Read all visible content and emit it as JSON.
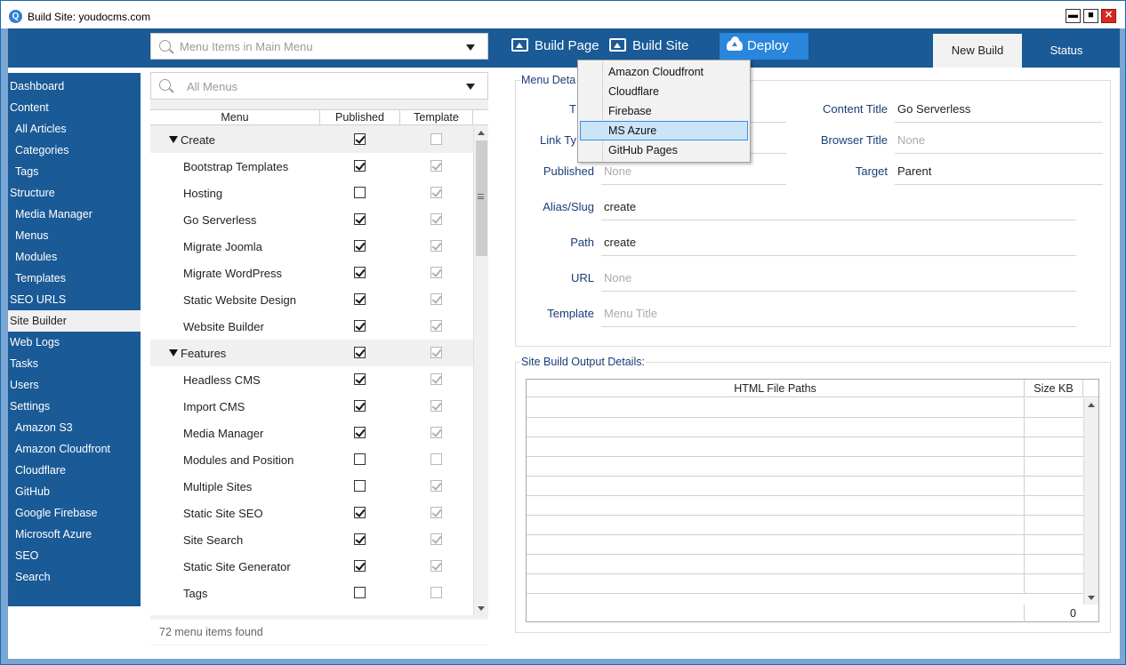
{
  "window": {
    "title": "Build Site: youdocms.com",
    "app_icon": "Q"
  },
  "window_controls": {
    "minimize": "▬",
    "maximize": "■",
    "close": "✕"
  },
  "toolbar": {
    "menu_search_placeholder": "Menu Items in Main Menu",
    "build_page": "Build Page",
    "build_site": "Build Site",
    "deploy": "Deploy"
  },
  "tabs": [
    {
      "label": "New Build",
      "active": true
    },
    {
      "label": "Status",
      "active": false
    }
  ],
  "sidebar": {
    "items": [
      {
        "label": "Dashboard"
      },
      {
        "label": "Content"
      },
      {
        "label": "All Articles"
      },
      {
        "label": "Categories"
      },
      {
        "label": "Tags"
      },
      {
        "label": "Structure"
      },
      {
        "label": "Media Manager"
      },
      {
        "label": "Menus"
      },
      {
        "label": "Modules"
      },
      {
        "label": "Templates"
      },
      {
        "label": "SEO URLS"
      },
      {
        "label": "Site Builder"
      },
      {
        "label": "Web Logs"
      },
      {
        "label": "Tasks"
      },
      {
        "label": "Users"
      },
      {
        "label": "Settings"
      },
      {
        "label": "Amazon S3"
      },
      {
        "label": "Amazon Cloudfront"
      },
      {
        "label": "Cloudflare"
      },
      {
        "label": "GitHub"
      },
      {
        "label": "Google Firebase"
      },
      {
        "label": "Microsoft Azure"
      },
      {
        "label": "SEO"
      },
      {
        "label": "Search"
      }
    ]
  },
  "menu_panel": {
    "filter_placeholder": "All Menus",
    "columns": [
      "Menu",
      "Published",
      "Template"
    ],
    "rows": [
      {
        "name": "Create",
        "group": true,
        "published": true,
        "template": false
      },
      {
        "name": "Bootstrap Templates",
        "published": true,
        "template": true
      },
      {
        "name": "Hosting",
        "published": false,
        "template": true
      },
      {
        "name": "Go Serverless",
        "published": true,
        "template": true
      },
      {
        "name": "Migrate Joomla",
        "published": true,
        "template": true
      },
      {
        "name": "Migrate WordPress",
        "published": true,
        "template": true
      },
      {
        "name": "Static Website Design",
        "published": true,
        "template": true
      },
      {
        "name": "Website Builder",
        "published": true,
        "template": true
      },
      {
        "name": "Features",
        "group": true,
        "published": true,
        "template": true
      },
      {
        "name": "Headless CMS",
        "published": true,
        "template": true
      },
      {
        "name": "Import CMS",
        "published": true,
        "template": true
      },
      {
        "name": "Media Manager",
        "published": true,
        "template": true
      },
      {
        "name": "Modules and Position",
        "published": false,
        "template": false
      },
      {
        "name": "Multiple Sites",
        "published": false,
        "template": true
      },
      {
        "name": "Static Site SEO",
        "published": true,
        "template": true
      },
      {
        "name": "Site Search",
        "published": true,
        "template": true
      },
      {
        "name": "Static Site Generator",
        "published": true,
        "template": true
      },
      {
        "name": "Tags",
        "published": false,
        "template": false
      }
    ],
    "footer": "72 menu items found"
  },
  "details": {
    "title": "Menu Deta",
    "title_label": "T",
    "link_type_label": "Link Ty",
    "published_label": "Published",
    "published_value": "None",
    "alias_label": "Alias/Slug",
    "alias_value": "create",
    "path_label": "Path",
    "path_value": "create",
    "url_label": "URL",
    "url_value": "None",
    "template_label": "Template",
    "template_value": "Menu Title",
    "content_title_label": "Content Title",
    "content_title_value": "Go Serverless",
    "browser_title_label": "Browser Title",
    "browser_title_value": "None",
    "target_label": "Target",
    "target_value": "Parent"
  },
  "output": {
    "title": "Site Build Output Details:",
    "col_paths": "HTML File Paths",
    "col_size": "Size KB",
    "total_size": "0"
  },
  "deploy_menu": {
    "items": [
      "Amazon Cloudfront",
      "Cloudflare",
      "Firebase",
      "MS Azure",
      "GitHub Pages"
    ],
    "highlighted": "MS Azure"
  }
}
